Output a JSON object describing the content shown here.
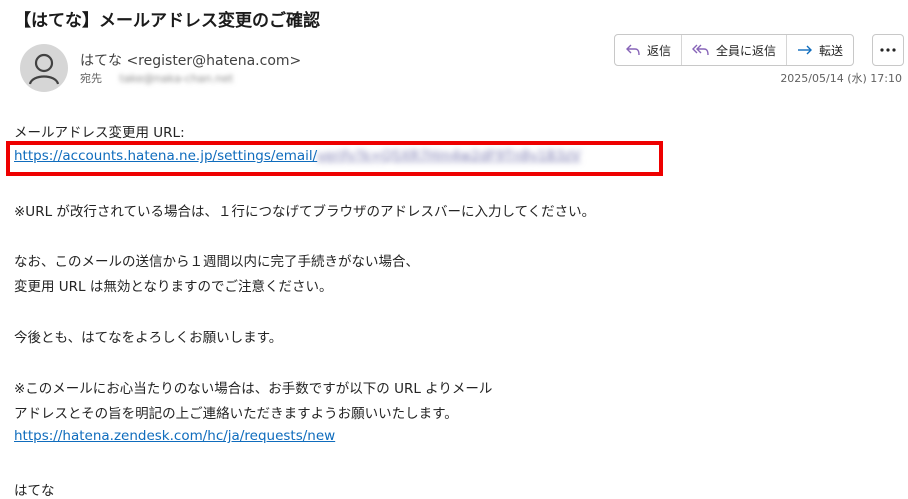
{
  "email": {
    "subject": "【はてな】メールアドレス変更のご確認",
    "sender_name": "はてな",
    "sender_email": "<register@hatena.com>",
    "to_label": "宛先",
    "to_address": "take@naka-chan.net",
    "date": "2025/05/14 (水) 17:10"
  },
  "actions": {
    "reply": "返信",
    "reply_all": "全員に返信",
    "forward": "転送"
  },
  "body": {
    "line1": "メールアドレス変更用 URL:",
    "url_visible": "https://accounts.hatena.ne.jp/settings/email/",
    "url_token": "verify?k=Q5XR7Hm4w2dF9Tn8y1B3zV",
    "line3": "※URL が改行されている場合は、１行につなげてブラウザのアドレスバーに入力してください。",
    "line4": "なお、このメールの送信から１週間以内に完了手続きがない場合、",
    "line5": "変更用 URL は無効となりますのでご注意ください。",
    "line6": "今後とも、はてなをよろしくお願いします。",
    "line7": "※このメールにお心当たりのない場合は、お手数ですが以下の URL よりメール",
    "line8": "アドレスとその旨を明記の上ご連絡いただきますようお願いいたします。",
    "support_url": "https://hatena.zendesk.com/hc/ja/requests/new",
    "signature": "はてな"
  },
  "colors": {
    "link": "#0f6cbd",
    "highlight_border": "#ee0000",
    "reply_icon": "#8764b8",
    "forward_icon": "#0f6cbd"
  }
}
